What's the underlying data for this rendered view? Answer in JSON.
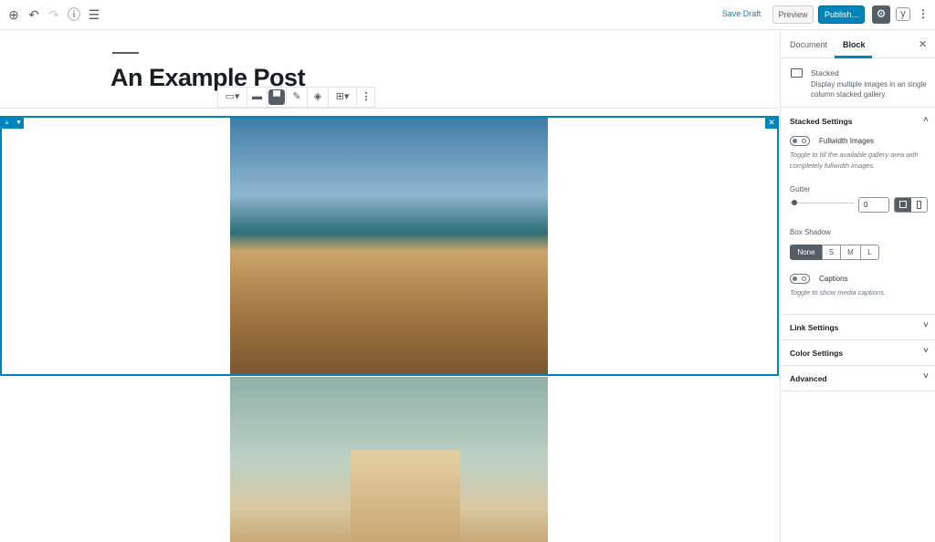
{
  "header": {
    "icons": [
      "add-block-icon",
      "undo-icon",
      "redo-icon",
      "info-icon",
      "block-navigation-icon"
    ],
    "save_draft": "Save Draft",
    "preview": "Preview",
    "publish": "Publish...",
    "settings_icon": "gear-icon",
    "yoast_icon": "y",
    "more_icon": "more-vertical-icon"
  },
  "post": {
    "title": "An Example Post"
  },
  "colors": {
    "accent": "#0085ba",
    "dark": "#555d66"
  },
  "sidebar": {
    "tabs": [
      "Document",
      "Block"
    ],
    "active_tab": "Block",
    "block": {
      "name": "Stacked",
      "description": "Display multiple images in an single column stacked gallery."
    },
    "stacked_settings": {
      "title": "Stacked Settings",
      "fullwidth_label": "Fullwidth Images",
      "fullwidth_on": false,
      "fullwidth_help": "Toggle to fill the available gallery area with completely fullwidth images.",
      "gutter_label": "Gutter",
      "gutter_value": "0",
      "box_shadow_label": "Box Shadow",
      "box_shadow_options": [
        "None",
        "S",
        "M",
        "L"
      ],
      "box_shadow_selected": "None",
      "captions_label": "Captions",
      "captions_on": false,
      "captions_help": "Toggle to show media captions."
    },
    "panels": [
      "Link Settings",
      "Color Settings",
      "Advanced"
    ]
  }
}
